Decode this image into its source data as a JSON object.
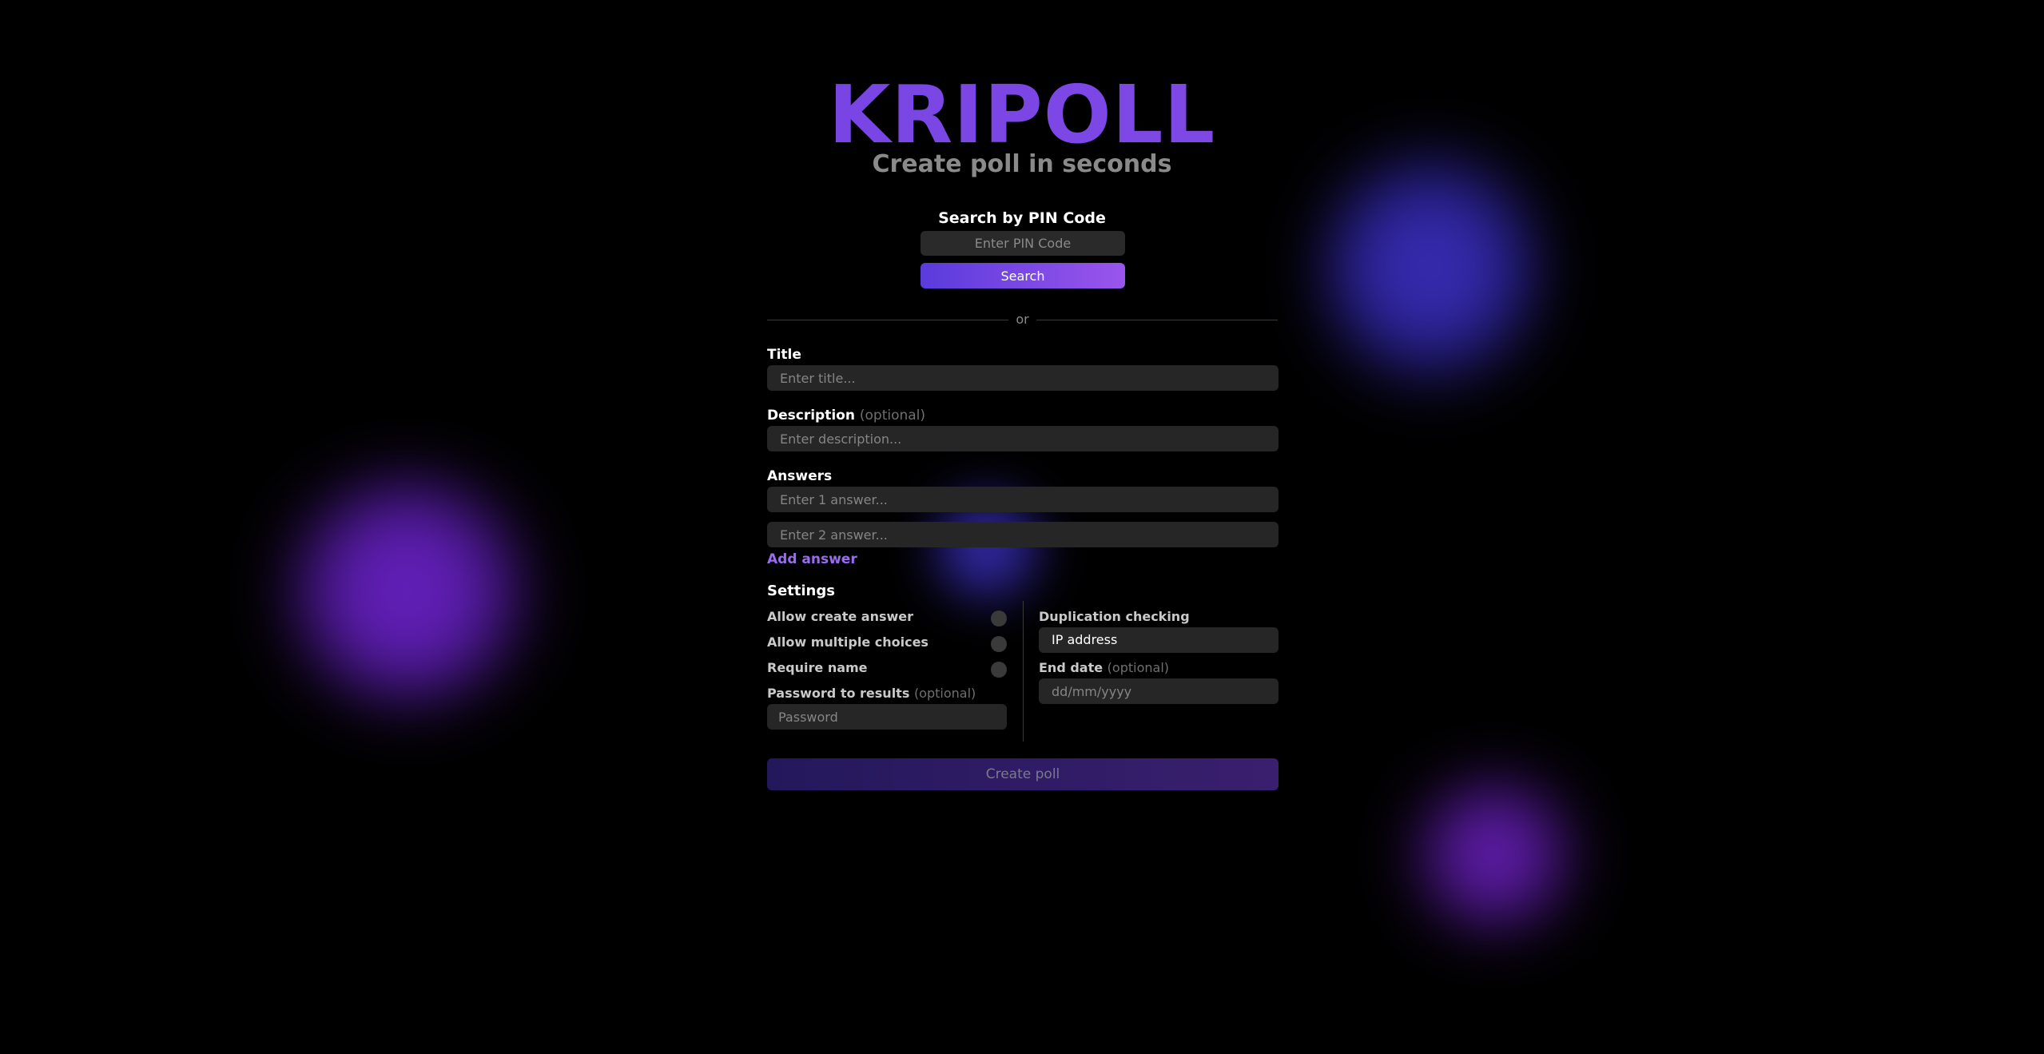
{
  "brand": {
    "logo": "KRIPOLL",
    "tagline": "Create poll in seconds"
  },
  "pin_search": {
    "label": "Search by PIN Code",
    "placeholder": "Enter PIN Code",
    "button": "Search"
  },
  "divider": "or",
  "form": {
    "title": {
      "label": "Title",
      "placeholder": "Enter title..."
    },
    "description": {
      "label": "Description",
      "optional": "(optional)",
      "placeholder": "Enter description..."
    },
    "answers": {
      "label": "Answers",
      "items": [
        {
          "placeholder": "Enter 1 answer..."
        },
        {
          "placeholder": "Enter 2 answer..."
        }
      ],
      "add_label": "Add answer"
    },
    "settings": {
      "title": "Settings",
      "toggles": [
        {
          "label": "Allow create answer"
        },
        {
          "label": "Allow multiple choices"
        },
        {
          "label": "Require name"
        }
      ],
      "password": {
        "label": "Password to results",
        "optional": "(optional)",
        "placeholder": "Password"
      },
      "duplication": {
        "label": "Duplication checking",
        "value": "IP address"
      },
      "end_date": {
        "label": "End date",
        "optional": "(optional)",
        "placeholder": "dd/mm/yyyy"
      }
    },
    "submit": "Create poll"
  },
  "colors": {
    "accent_start": "#5a3bdc",
    "accent_end": "#9a55ec",
    "link": "#9b6cf0",
    "background": "#000000"
  }
}
